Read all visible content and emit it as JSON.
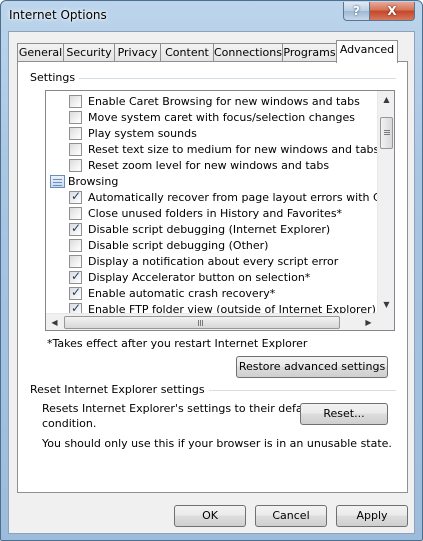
{
  "window": {
    "title": "Internet Options",
    "help_glyph": "?",
    "close_glyph": "X"
  },
  "tabs": [
    "General",
    "Security",
    "Privacy",
    "Content",
    "Connections",
    "Programs",
    "Advanced"
  ],
  "settings": {
    "group_label": "Settings",
    "items": [
      {
        "type": "checkbox",
        "checked": false,
        "label": "Enable Caret Browsing for new windows and tabs"
      },
      {
        "type": "checkbox",
        "checked": false,
        "label": "Move system caret with focus/selection changes"
      },
      {
        "type": "checkbox",
        "checked": false,
        "label": "Play system sounds"
      },
      {
        "type": "checkbox",
        "checked": false,
        "label": "Reset text size to medium for new windows and tabs"
      },
      {
        "type": "checkbox",
        "checked": false,
        "label": "Reset zoom level for new windows and tabs"
      },
      {
        "type": "group",
        "label": "Browsing"
      },
      {
        "type": "checkbox",
        "checked": true,
        "label": "Automatically recover from page layout errors with Compa"
      },
      {
        "type": "checkbox",
        "checked": false,
        "label": "Close unused folders in History and Favorites*"
      },
      {
        "type": "checkbox",
        "checked": true,
        "label": "Disable script debugging (Internet Explorer)"
      },
      {
        "type": "checkbox",
        "checked": false,
        "label": "Disable script debugging (Other)"
      },
      {
        "type": "checkbox",
        "checked": false,
        "label": "Display a notification about every script error"
      },
      {
        "type": "checkbox",
        "checked": true,
        "label": "Display Accelerator button on selection*"
      },
      {
        "type": "checkbox",
        "checked": true,
        "label": "Enable automatic crash recovery*"
      },
      {
        "type": "checkbox",
        "checked": true,
        "label": "Enable FTP folder view (outside of Internet Explorer)"
      }
    ],
    "footnote": "*Takes effect after you restart Internet Explorer",
    "restore_label": "Restore advanced settings"
  },
  "reset": {
    "group_label": "Reset Internet Explorer settings",
    "description_line1": "Resets Internet Explorer's settings to their default",
    "description_line2": "condition.",
    "button_label": "Reset...",
    "warning": "You should only use this if your browser is in an unusable state."
  },
  "footer": {
    "ok_label": "OK",
    "cancel_label": "Cancel",
    "apply_label": "Apply"
  },
  "colors": {
    "title_bar": "#a9c6e3",
    "dialog_bg": "#f0f0f0",
    "checkmark": "#233c78",
    "close_button": "#c4462a"
  }
}
